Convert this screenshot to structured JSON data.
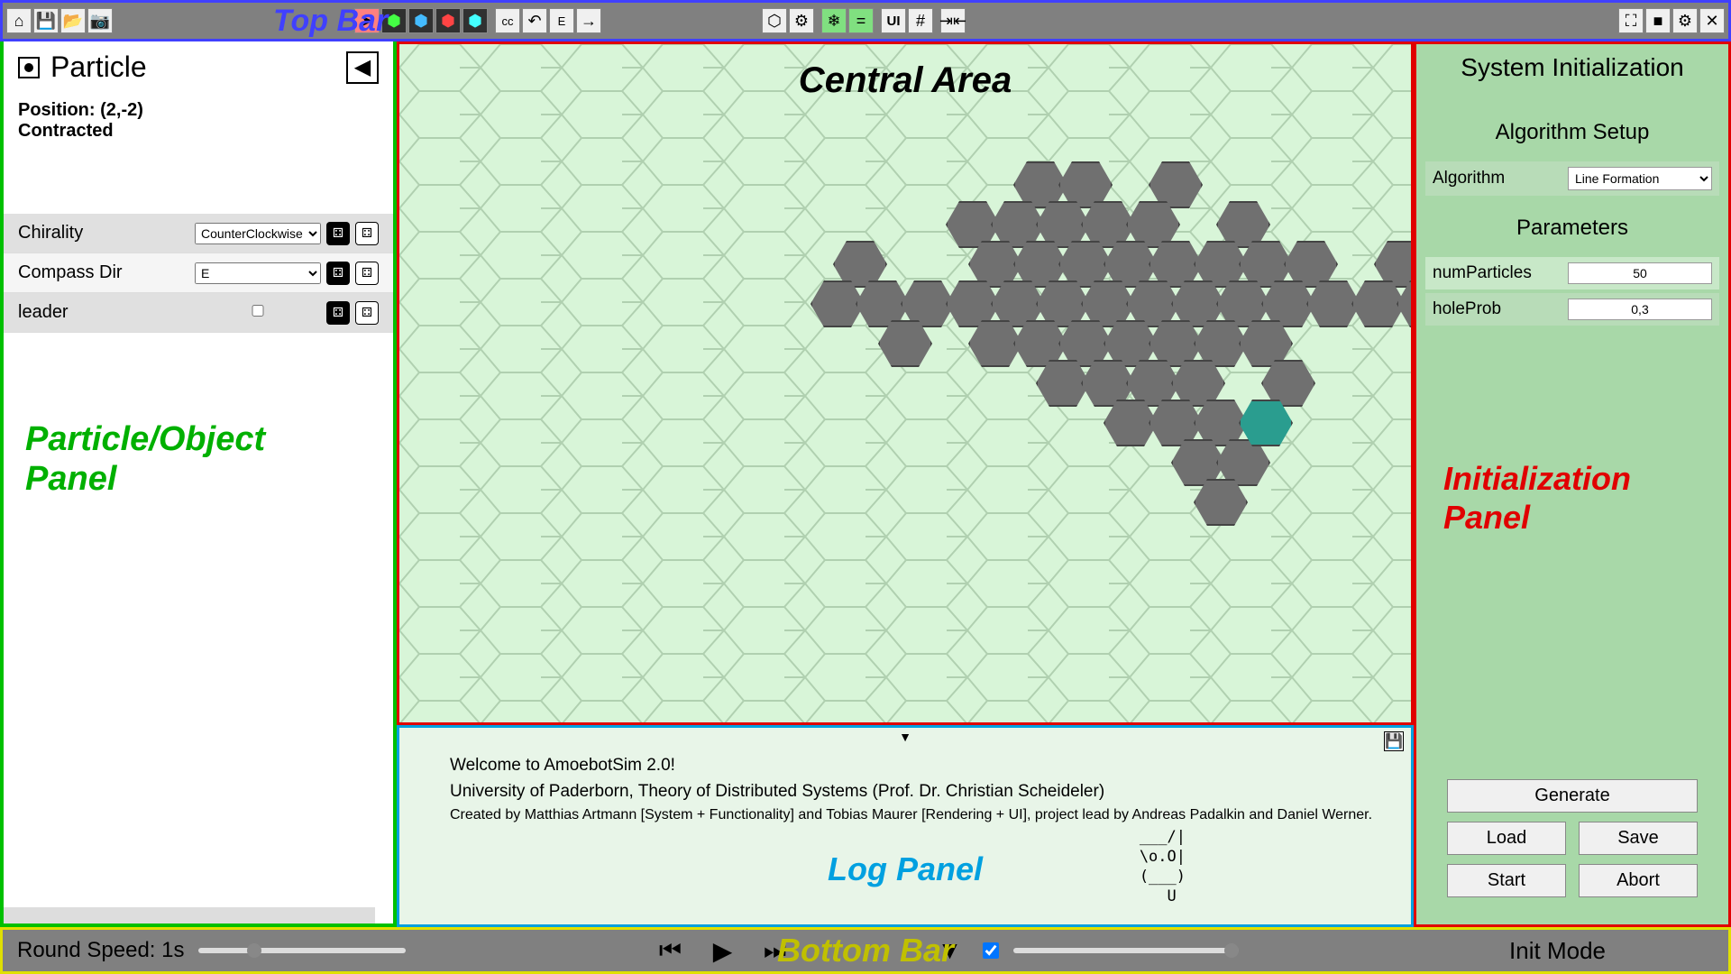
{
  "annotations": {
    "top_bar": "Top Bar",
    "central": "Central Area",
    "left_panel": "Particle/Object Panel",
    "log_panel": "Log Panel",
    "right_panel": "Initialization Panel",
    "bottom_bar": "Bottom Bar"
  },
  "top_bar": {
    "cc_label": "cc",
    "e_label": "E",
    "ui_label": "UI"
  },
  "left_panel": {
    "title": "Particle",
    "position_label": "Position:",
    "position_value": "(2,-2)",
    "state": "Contracted",
    "props": [
      {
        "name": "Chirality",
        "value": "CounterClockwise",
        "type": "select"
      },
      {
        "name": "Compass Dir",
        "value": "E",
        "type": "select"
      },
      {
        "name": "leader",
        "value": "",
        "type": "checkbox"
      }
    ]
  },
  "log": {
    "line1": "Welcome to AmoebotSim 2.0!",
    "line2": "University of Paderborn, Theory of Distributed Systems (Prof. Dr. Christian Scheideler)",
    "line3": "Created by Matthias Artmann [System + Functionality] and Tobias Maurer [Rendering + UI], project lead by Andreas Padalkin and Daniel Werner.",
    "ascii": "___/|\n\\o.O|\n(___)\n  U"
  },
  "right_panel": {
    "title": "System Initialization",
    "section_algo": "Algorithm Setup",
    "algo_label": "Algorithm",
    "algo_value": "Line Formation",
    "section_params": "Parameters",
    "params": [
      {
        "name": "numParticles",
        "value": "50"
      },
      {
        "name": "holeProb",
        "value": "0,3"
      }
    ],
    "btn_generate": "Generate",
    "btn_load": "Load",
    "btn_save": "Save",
    "btn_start": "Start",
    "btn_abort": "Abort"
  },
  "bottom_bar": {
    "speed_label": "Round Speed: 1s",
    "mode": "Init Mode"
  },
  "hex_positions": [
    [
      120,
      0
    ],
    [
      170,
      0
    ],
    [
      270,
      0
    ],
    [
      45,
      44
    ],
    [
      95,
      44
    ],
    [
      145,
      44
    ],
    [
      195,
      44
    ],
    [
      245,
      44
    ],
    [
      345,
      44
    ],
    [
      -80,
      88
    ],
    [
      70,
      88
    ],
    [
      120,
      88
    ],
    [
      170,
      88
    ],
    [
      220,
      88
    ],
    [
      270,
      88
    ],
    [
      320,
      88
    ],
    [
      370,
      88
    ],
    [
      420,
      88
    ],
    [
      520,
      88
    ],
    [
      570,
      88
    ],
    [
      770,
      88
    ],
    [
      820,
      88
    ],
    [
      -105,
      132
    ],
    [
      -55,
      132
    ],
    [
      -5,
      132
    ],
    [
      45,
      132
    ],
    [
      95,
      132
    ],
    [
      145,
      132
    ],
    [
      195,
      132
    ],
    [
      245,
      132
    ],
    [
      295,
      132
    ],
    [
      345,
      132
    ],
    [
      395,
      132
    ],
    [
      445,
      132
    ],
    [
      495,
      132
    ],
    [
      545,
      132
    ],
    [
      595,
      132
    ],
    [
      645,
      132
    ],
    [
      695,
      132
    ],
    [
      795,
      132
    ],
    [
      845,
      132
    ],
    [
      895,
      132
    ],
    [
      -30,
      176
    ],
    [
      70,
      176
    ],
    [
      120,
      176
    ],
    [
      170,
      176
    ],
    [
      220,
      176
    ],
    [
      270,
      176
    ],
    [
      320,
      176
    ],
    [
      370,
      176
    ],
    [
      620,
      176
    ],
    [
      820,
      176
    ],
    [
      870,
      176
    ],
    [
      145,
      220
    ],
    [
      195,
      220
    ],
    [
      245,
      220
    ],
    [
      295,
      220
    ],
    [
      395,
      220
    ],
    [
      820,
      220
    ],
    [
      220,
      264
    ],
    [
      270,
      264
    ],
    [
      320,
      264
    ],
    [
      295,
      308
    ],
    [
      345,
      308
    ],
    [
      320,
      352
    ]
  ],
  "hex_teal": [
    370,
    264
  ]
}
